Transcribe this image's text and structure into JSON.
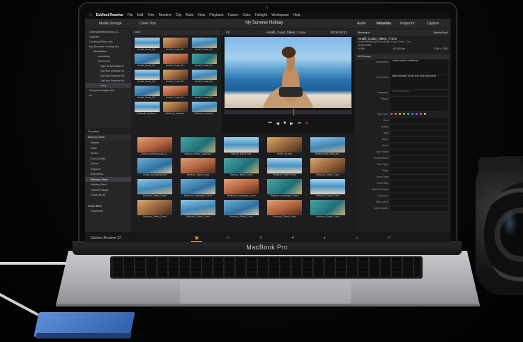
{
  "laptop": {
    "brand": "MacBook Pro"
  },
  "menubar": {
    "app": "DaVinci Resolve",
    "items": [
      "File",
      "Edit",
      "Trim",
      "Timeline",
      "Clip",
      "Mark",
      "View",
      "Playback",
      "Fusion",
      "Color",
      "Fairlight",
      "Workspace",
      "Help"
    ]
  },
  "toolbar": {
    "media_storage": "Media Storage",
    "clone_tool": "Clone Tool",
    "project_title": "My Summer Holiday",
    "audio": "Audio",
    "metadata": "Metadata",
    "inspector": "Inspector",
    "capture": "Capture"
  },
  "tree": {
    "items": [
      {
        "label": "/Users/Brett/Movies Co...",
        "level": 0
      },
      {
        "label": "Capture",
        "level": 0
      },
      {
        "label": "Cooking Show_dta",
        "level": 0
      },
      {
        "label": "My Summer Holiday.dta",
        "level": 0
      },
      {
        "label": "MediaFiles",
        "level": 1
      },
      {
        "label": "marketing",
        "level": 2
      },
      {
        "label": "UGcreens",
        "level": 2
      },
      {
        "label": "Age Of Aeroplanes",
        "level": 3
      },
      {
        "label": "DaVinci Resolve 11",
        "level": 3
      },
      {
        "label": "DaVinci Resolve W...",
        "level": 3
      },
      {
        "label": "DaVinci Resolve W...",
        "level": 3
      },
      {
        "label": "color",
        "level": 3,
        "selected": true
      },
      {
        "label": "Shaqalu Knights.dta",
        "level": 0
      },
      {
        "label": "ss",
        "level": 0
      }
    ],
    "favorites": "Favorites"
  },
  "grid1": {
    "header": "color",
    "captions": [
      "Amalfi_Coast_Tal...",
      "Amalfi_Coast_Tal...",
      "Amalfi_Coast_Tal...",
      "Amalfi_Coast_Tal...",
      "Amalfi_Coast_Tal...",
      "Amalfi_Coast_Tal...",
      "Amalfi_Coast_Tal...",
      "Amalfi_Coast_Tal...",
      "Amalfi_Coast_Tal...",
      "Amalfi_Coast_Tal...",
      "Amalfi_Coast_Tal...",
      "Amalfi_Coast_Tal...",
      "Redbook_Landsca...",
      "Redbook_Landsca...",
      "Redbook_Landsca..."
    ]
  },
  "viewer": {
    "clip": "Amalfi_Coast_Talent_7.mov",
    "timecode": "00:00:00:22",
    "zoom": "Fit"
  },
  "bins": {
    "header": "Balcony View",
    "items": [
      "Master",
      "Edits",
      "Audio",
      "End Credits",
      "Drone",
      "Airports",
      "Interviews",
      "Balcony View",
      "Holiday Reel",
      "Yacht Footage",
      "Extra Shots"
    ],
    "selected": "Balcony View",
    "smart_bins": "Smart Bins",
    "keywords": "Keywords"
  },
  "grid2": {
    "captions": [
      "woman_swimming_sun_b...",
      "balcony_seeing_coast.mp4",
      "Balcony leg roll.mp4",
      "Under_hot.mov",
      "Holiday family sitting ba...",
      "Ocean_by_balcony.mp4",
      "Redbook_Talent 5.mov",
      "Balcony_Talent_3.mov",
      "Redbook_Talent 7.mov",
      "Redbook_Talent_7.mov",
      "Redbook_Talent_3.mp4",
      "Redbook_Landscape_3.mov",
      "Redbook_Landscape_4.mov",
      "Redbook_Landscape_3.mov",
      "Redbook_Talent_2.mov",
      "Redbook_Talent_2.mov",
      "Redbook_Talent_2.mov",
      "Redbook_Talent_2.mov",
      "Redbook_Talent_2.mov",
      "Redbook_Talent_2.mov"
    ]
  },
  "metadata": {
    "header": "Metadata",
    "media_pool": "Media Pool",
    "clip_name": "Amalfi_Coast_Talent_7.mov",
    "clip_path": "/Users/Brett/Movies/Color/Amalfi_Coast_Talent_7.mov",
    "timecode": "00:00:00:22",
    "codec": "H.264",
    "fps": "60.000 fps",
    "resolution": "3196 x 1280",
    "group": "All Groups",
    "description": "Coffee scene on balcony",
    "comments": "Insert between drone shot and boat scene",
    "keywords_placeholder": "Enter Keywords",
    "fields": [
      "Shot",
      "Scene",
      "Take",
      "Angle",
      "Move",
      "Day / Night",
      "Environment",
      "Shot Type",
      "Flags",
      "Good Take",
      "Shoot Day",
      "Date Recorded",
      "Camera #",
      "Roll Card #",
      "Clip Number"
    ],
    "labels": [
      "Description",
      "Comments",
      "Keywords",
      "People",
      "Clip Color"
    ],
    "clip_colors": [
      "#e04b4b",
      "#e08a3a",
      "#e3c93f",
      "#7bcf4a",
      "#41b7a8",
      "#3f8fe0",
      "#8a5be0",
      "#e05bb7",
      "#bbbbbb"
    ]
  },
  "pagetabs": {
    "app": "DaVinci Resolve 17",
    "tabs": [
      "media",
      "cut",
      "edit",
      "fusion",
      "color",
      "fairlight",
      "deliver"
    ],
    "active": "media"
  }
}
